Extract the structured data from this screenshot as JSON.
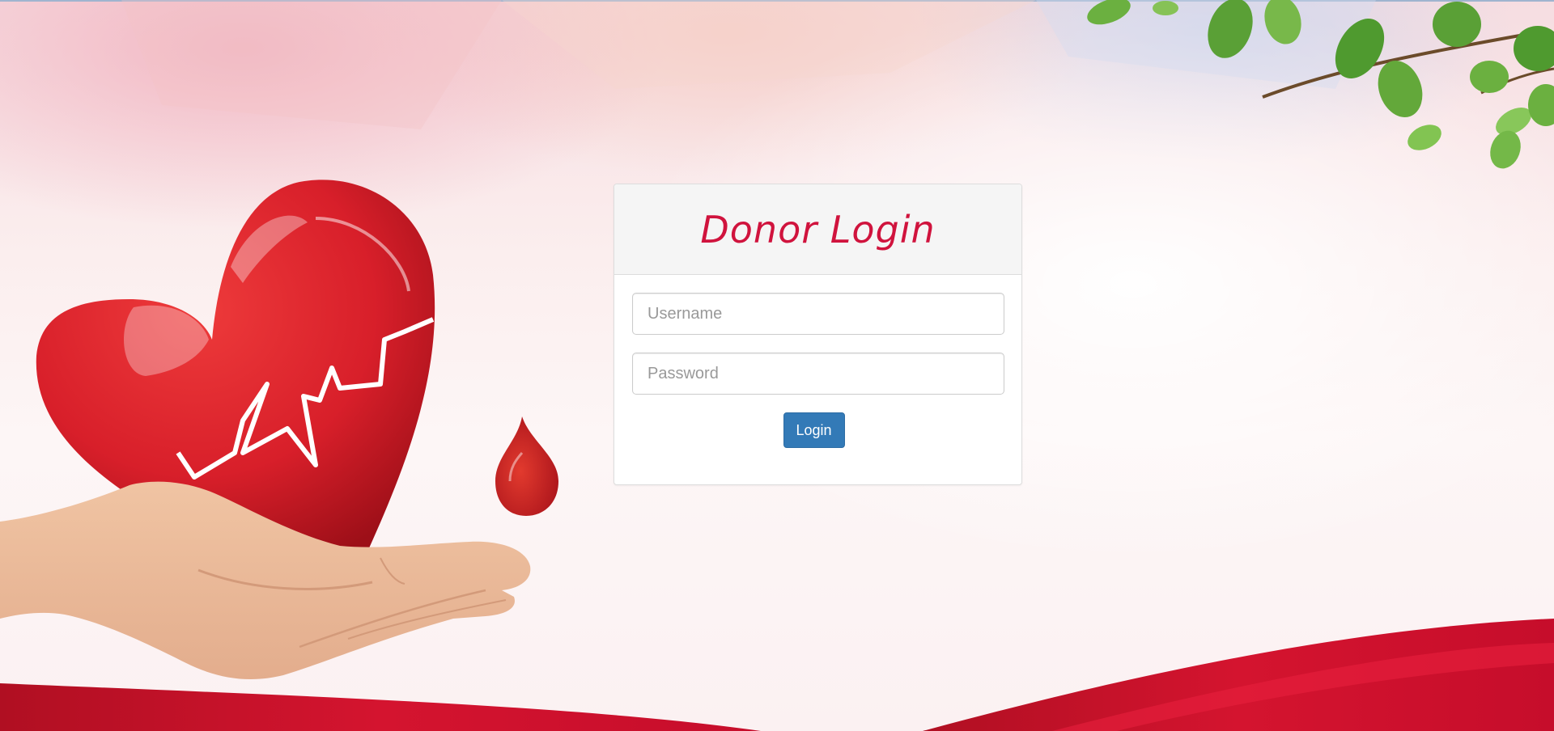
{
  "login": {
    "title": "Donor Login",
    "username_placeholder": "Username",
    "username_value": "",
    "password_placeholder": "Password",
    "password_value": "",
    "button_label": "Login"
  },
  "colors": {
    "title": "#d0133d",
    "button": "#337ab7",
    "heart": "#d81f2a",
    "ribbon": "#c8102e",
    "leaves": "#5aa036"
  },
  "illustration": {
    "icons": [
      "heart-icon",
      "heartbeat-line-icon",
      "hand-icon",
      "blood-drop-icon",
      "leaves-icon",
      "ribbon-icon"
    ]
  }
}
